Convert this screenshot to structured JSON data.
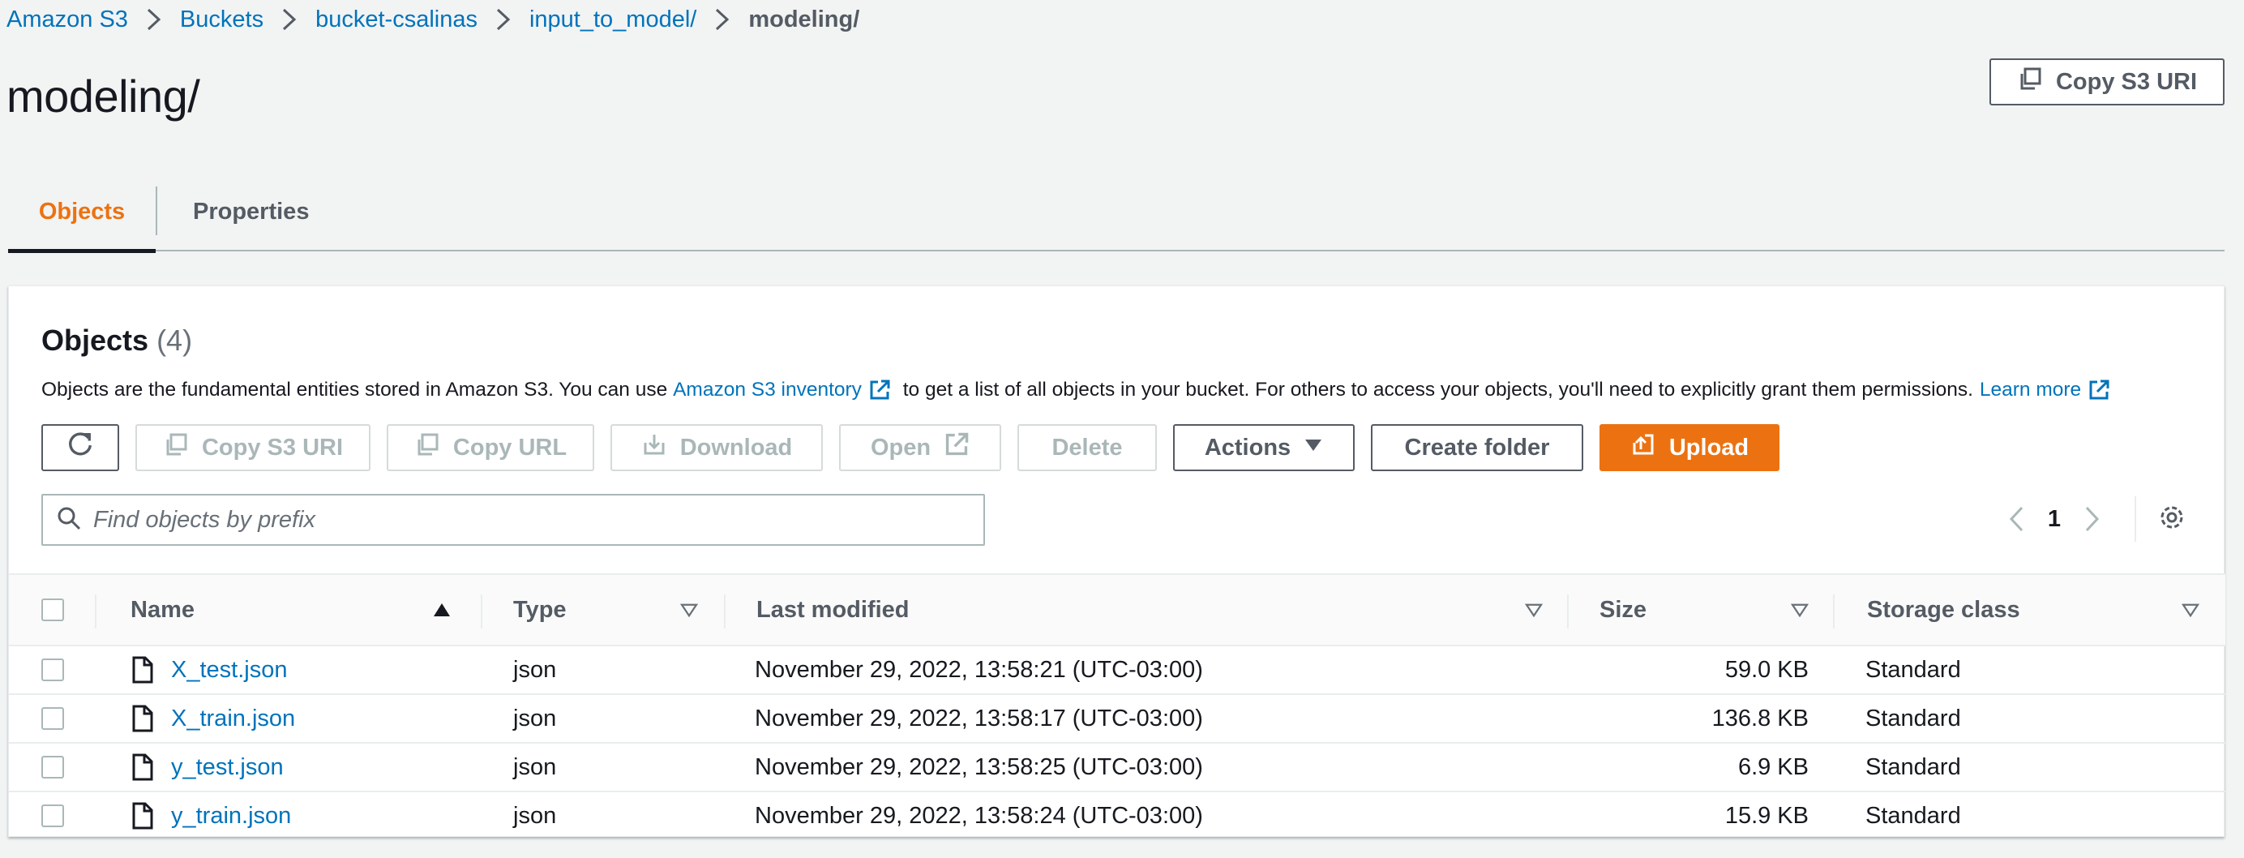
{
  "breadcrumb": [
    "Amazon S3",
    "Buckets",
    "bucket-csalinas",
    "input_to_model/",
    "modeling/"
  ],
  "page_title": "modeling/",
  "header_actions": {
    "copy_s3_uri": "Copy S3 URI"
  },
  "tabs": [
    {
      "label": "Objects",
      "active": true
    },
    {
      "label": "Properties",
      "active": false
    }
  ],
  "objects_panel": {
    "title": "Objects",
    "count": "(4)",
    "description": {
      "part1": "Objects are the fundamental entities stored in Amazon S3. You can use ",
      "link1": "Amazon S3 inventory",
      "part2": " to get a list of all objects in your bucket. For others to access your objects, you'll need to explicitly grant them permissions.",
      "link2": "Learn more"
    },
    "toolbar": {
      "copy_s3_uri": "Copy S3 URI",
      "copy_url": "Copy URL",
      "download": "Download",
      "open": "Open",
      "delete": "Delete",
      "actions": "Actions",
      "create_folder": "Create folder",
      "upload": "Upload"
    },
    "search": {
      "placeholder": "Find objects by prefix",
      "value": ""
    },
    "pagination": {
      "current_page": "1"
    },
    "table": {
      "columns": [
        "Name",
        "Type",
        "Last modified",
        "Size",
        "Storage class"
      ],
      "rows": [
        {
          "name": "X_test.json",
          "type": "json",
          "last_modified": "November 29, 2022, 13:58:21 (UTC-03:00)",
          "size": "59.0 KB",
          "storage_class": "Standard"
        },
        {
          "name": "X_train.json",
          "type": "json",
          "last_modified": "November 29, 2022, 13:58:17 (UTC-03:00)",
          "size": "136.8 KB",
          "storage_class": "Standard"
        },
        {
          "name": "y_test.json",
          "type": "json",
          "last_modified": "November 29, 2022, 13:58:25 (UTC-03:00)",
          "size": "6.9 KB",
          "storage_class": "Standard"
        },
        {
          "name": "y_train.json",
          "type": "json",
          "last_modified": "November 29, 2022, 13:58:24 (UTC-03:00)",
          "size": "15.9 KB",
          "storage_class": "Standard"
        }
      ]
    }
  },
  "colors": {
    "link": "#0073bb",
    "accent": "#ec7211",
    "text": "#16191f",
    "muted": "#545b64"
  }
}
